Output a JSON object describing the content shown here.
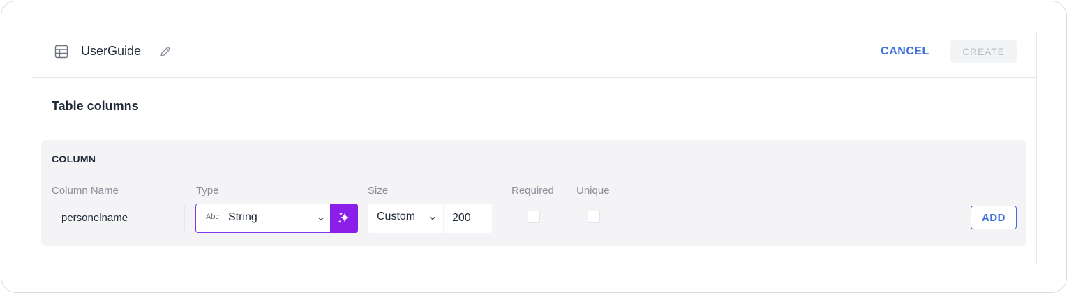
{
  "header": {
    "title": "UserGuide",
    "cancel_label": "CANCEL",
    "create_label": "CREATE"
  },
  "section_title": "Table columns",
  "column_panel": {
    "title": "COLUMN",
    "labels": {
      "column_name": "Column Name",
      "type": "Type",
      "size": "Size",
      "required": "Required",
      "unique": "Unique"
    },
    "column_name_value": "personelname",
    "type_icon_text": "Abc",
    "type_value": "String",
    "size_mode": "Custom",
    "size_value": "200",
    "required_checked": false,
    "unique_checked": false,
    "add_label": "ADD"
  },
  "icons": {
    "table": "table-icon",
    "edit": "pencil-icon",
    "type_chevron": "chevron-down-icon",
    "magic": "sparkles-icon",
    "size_chevron": "chevron-down-icon"
  },
  "colors": {
    "accent_blue": "#3b6ddb",
    "accent_purple": "#8b1ee8",
    "panel_bg": "#f4f4f6",
    "disabled_text": "#b7bbc3"
  }
}
